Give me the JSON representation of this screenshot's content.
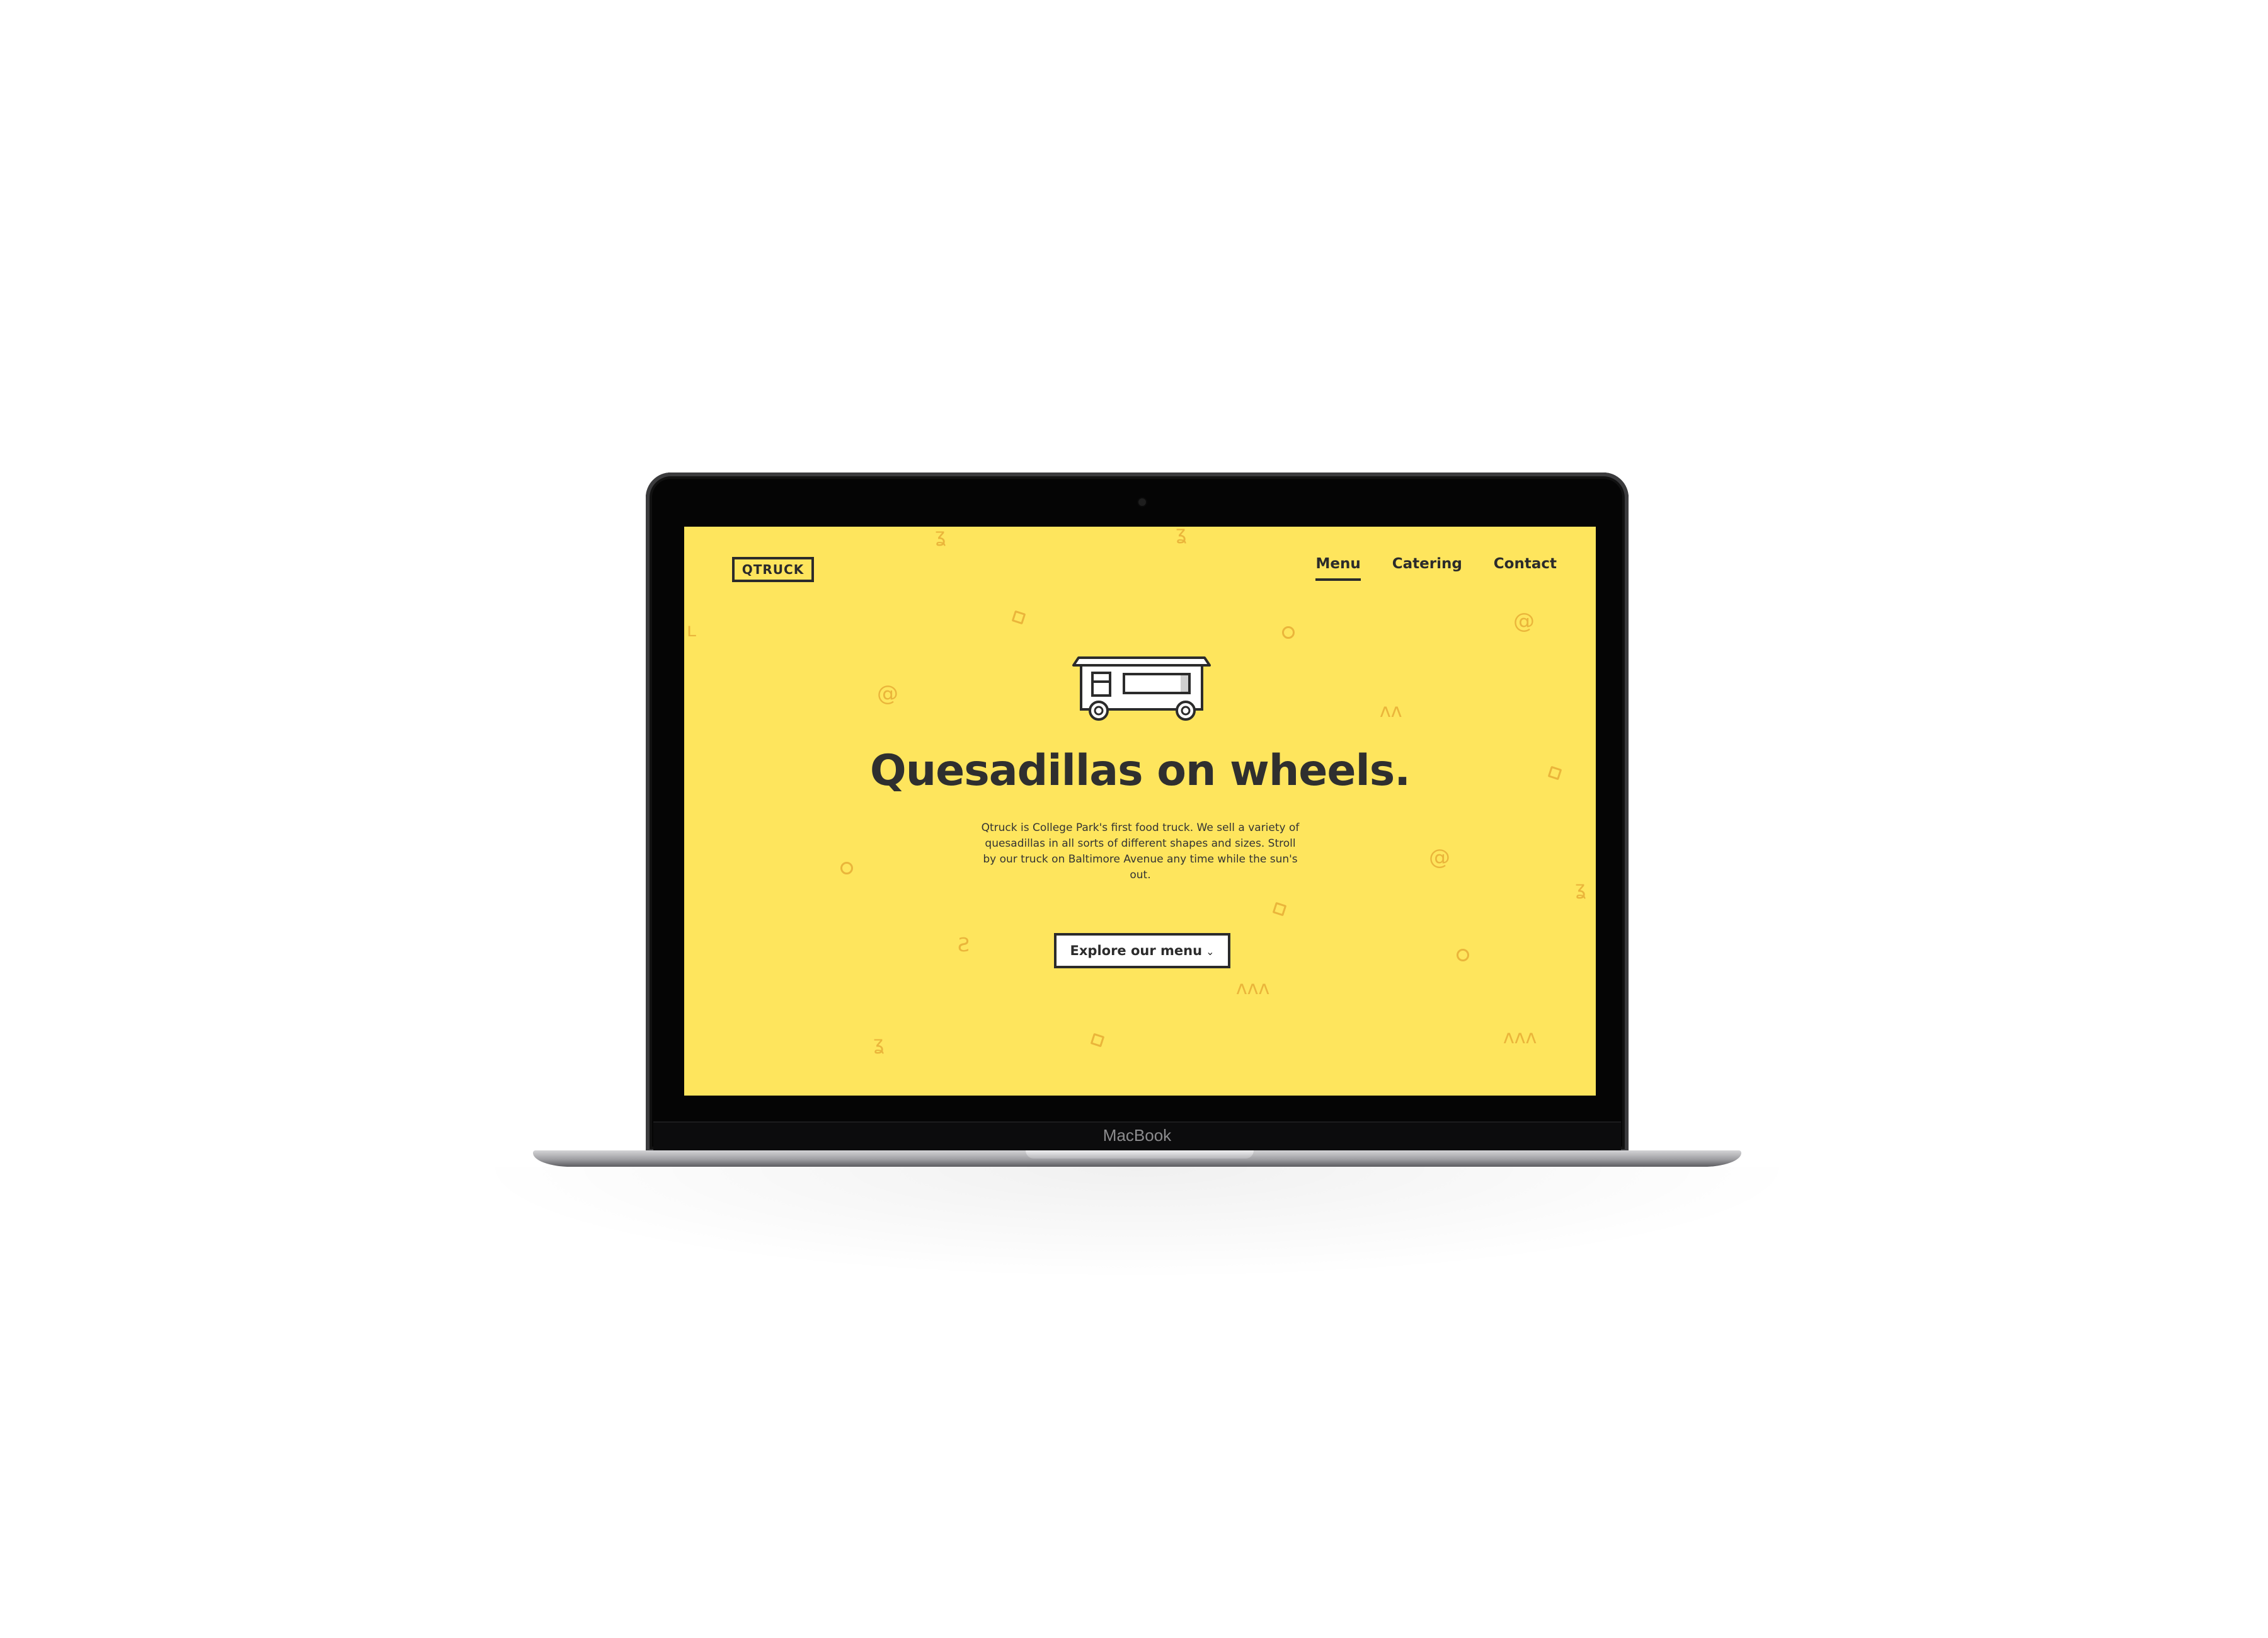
{
  "device": {
    "brand_label": "MacBook"
  },
  "site": {
    "logo_text": "QTRUCK",
    "nav": [
      {
        "label": "Menu",
        "active": true
      },
      {
        "label": "Catering",
        "active": false
      },
      {
        "label": "Contact",
        "active": false
      }
    ],
    "hero": {
      "icon": "food-truck-icon",
      "headline": "Quesadillas on wheels.",
      "description": "Qtruck is College Park's first food truck. We sell a variety of quesadillas in all sorts of different shapes and sizes. Stroll by our truck on Baltimore Avenue any time while the sun's out.",
      "cta_label": "Explore our menu",
      "cta_icon": "chevron-down-icon"
    }
  },
  "colors": {
    "background": "#fee55d",
    "decoration": "#eab53b",
    "text": "#2f2f2f",
    "button_bg": "#ffffff"
  }
}
